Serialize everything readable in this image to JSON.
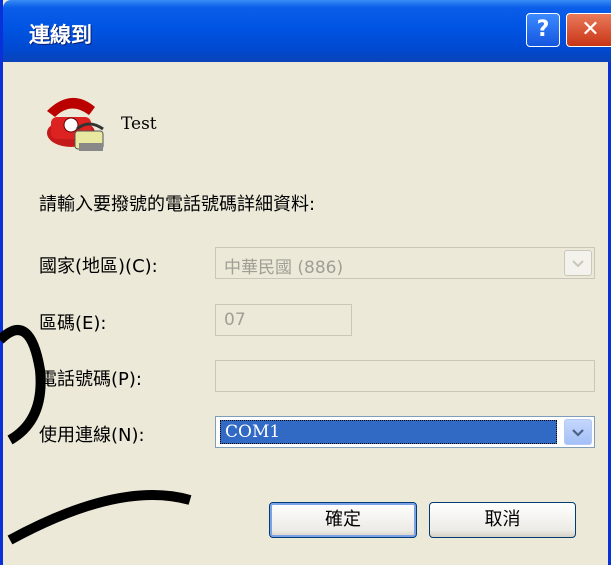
{
  "window": {
    "title": "連線到",
    "help_label": "?",
    "close_label": "✕"
  },
  "connection": {
    "name": "Test",
    "icon": "phone-icon"
  },
  "form": {
    "instruction": "請輸入要撥號的電話號碼詳細資料:",
    "country_label": "國家(地區)(C):",
    "country_value": "中華民國 (886)",
    "area_label": "區碼(E):",
    "area_value": "07",
    "phone_label": "電話號碼(P):",
    "phone_value": "",
    "connect_label": "使用連線(N):",
    "connect_value": "COM1"
  },
  "buttons": {
    "ok": "確定",
    "cancel": "取消"
  },
  "colors": {
    "titlebar": "#0054e3",
    "selection": "#316ac5",
    "dialog_bg": "#ece9d8"
  }
}
